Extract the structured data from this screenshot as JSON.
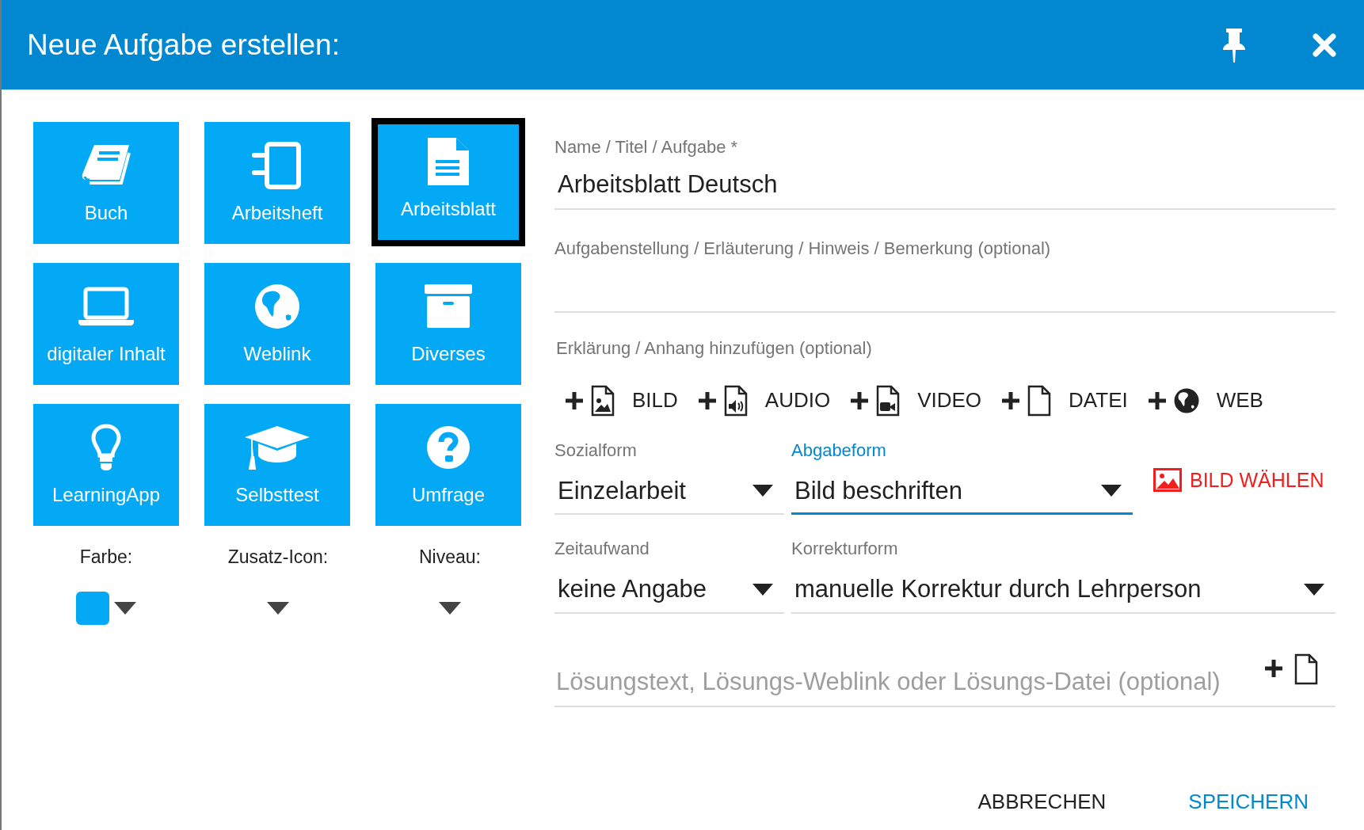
{
  "dialog": {
    "title": "Neue Aufgabe erstellen:"
  },
  "tiles": [
    {
      "label": "Buch",
      "kind": "book",
      "selected": false
    },
    {
      "label": "Arbeitsheft",
      "kind": "notebook",
      "selected": false
    },
    {
      "label": "Arbeitsblatt",
      "kind": "sheet",
      "selected": true
    },
    {
      "label": "digitaler Inhalt",
      "kind": "laptop",
      "selected": false
    },
    {
      "label": "Weblink",
      "kind": "globe",
      "selected": false
    },
    {
      "label": "Diverses",
      "kind": "archive",
      "selected": false
    },
    {
      "label": "LearningApp",
      "kind": "bulb",
      "selected": false
    },
    {
      "label": "Selbsttest",
      "kind": "cap",
      "selected": false
    },
    {
      "label": "Umfrage",
      "kind": "question",
      "selected": false
    }
  ],
  "pickers": [
    {
      "label": "Farbe:",
      "color": "#03a9f4"
    },
    {
      "label": "Zusatz-Icon:"
    },
    {
      "label": "Niveau:"
    }
  ],
  "name_field": {
    "label": "Name / Titel / Aufgabe *",
    "value": "Arbeitsblatt Deutsch"
  },
  "description_field": {
    "label": "Aufgabenstellung / Erläuterung / Hinweis / Bemerkung (optional)"
  },
  "attachments": {
    "label": "Erklärung / Anhang hinzufügen (optional)",
    "items": [
      {
        "label": "BILD",
        "kind": "image"
      },
      {
        "label": "AUDIO",
        "kind": "audio"
      },
      {
        "label": "VIDEO",
        "kind": "video"
      },
      {
        "label": "DATEI",
        "kind": "file"
      },
      {
        "label": "WEB",
        "kind": "globe"
      }
    ]
  },
  "selects_row_1": [
    {
      "label": "Sozialform",
      "value": "Einzelarbeit",
      "focused": false
    },
    {
      "label": "Abgabeform",
      "value": "Bild beschriften",
      "focused": true
    }
  ],
  "choose_image_button": "BILD WÄHLEN",
  "selects_row_2": [
    {
      "label": "Zeitaufwand",
      "value": "keine Angabe",
      "focused": false
    },
    {
      "label": "Korrekturform",
      "value": "manuelle Korrektur durch Lehrperson",
      "focused": false
    }
  ],
  "solution_field": {
    "placeholder": "Lösungstext, Lösungs-Weblink oder Lösungs-Datei (optional)"
  },
  "buttons": [
    {
      "label": "ABBRECHEN",
      "kind": "cancel"
    },
    {
      "label": "SPEICHERN",
      "kind": "primary"
    }
  ]
}
